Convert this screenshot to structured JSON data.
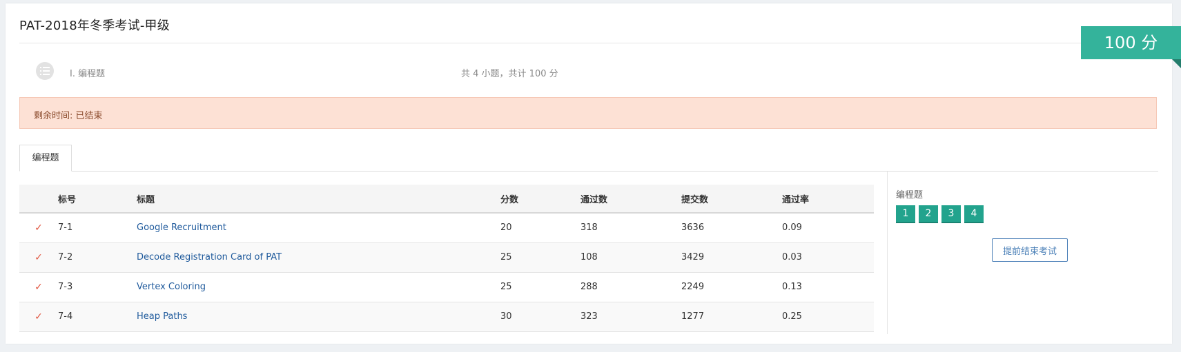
{
  "exam_title": "PAT-2018年冬季考试-甲级",
  "section": {
    "label": "I. 编程题",
    "summary": "共 4 小题，共计 100 分"
  },
  "score_badge": "100 分",
  "timer_text": "剩余时间: 已结束",
  "tabs": [
    {
      "label": "编程题"
    }
  ],
  "table": {
    "headers": [
      "",
      "标号",
      "标题",
      "分数",
      "通过数",
      "提交数",
      "通过率"
    ],
    "rows": [
      {
        "status": "✓",
        "id": "7-1",
        "title": "Google Recruitment",
        "score": "20",
        "passed": "318",
        "submitted": "3636",
        "rate": "0.09"
      },
      {
        "status": "✓",
        "id": "7-2",
        "title": "Decode Registration Card of PAT",
        "score": "25",
        "passed": "108",
        "submitted": "3429",
        "rate": "0.03"
      },
      {
        "status": "✓",
        "id": "7-3",
        "title": "Vertex Coloring",
        "score": "25",
        "passed": "288",
        "submitted": "2249",
        "rate": "0.13"
      },
      {
        "status": "✓",
        "id": "7-4",
        "title": "Heap Paths",
        "score": "30",
        "passed": "323",
        "submitted": "1277",
        "rate": "0.25"
      }
    ]
  },
  "side_panel": {
    "label": "编程题",
    "question_numbers": [
      "1",
      "2",
      "3",
      "4"
    ],
    "end_exam_button": "提前结束考试"
  },
  "colors": {
    "accent_teal": "#34b39b",
    "timer_bg": "#fde1d5",
    "link_blue": "#1f5a9c",
    "check_red": "#e0533d"
  },
  "icons": [
    "list-icon",
    "check-icon"
  ]
}
